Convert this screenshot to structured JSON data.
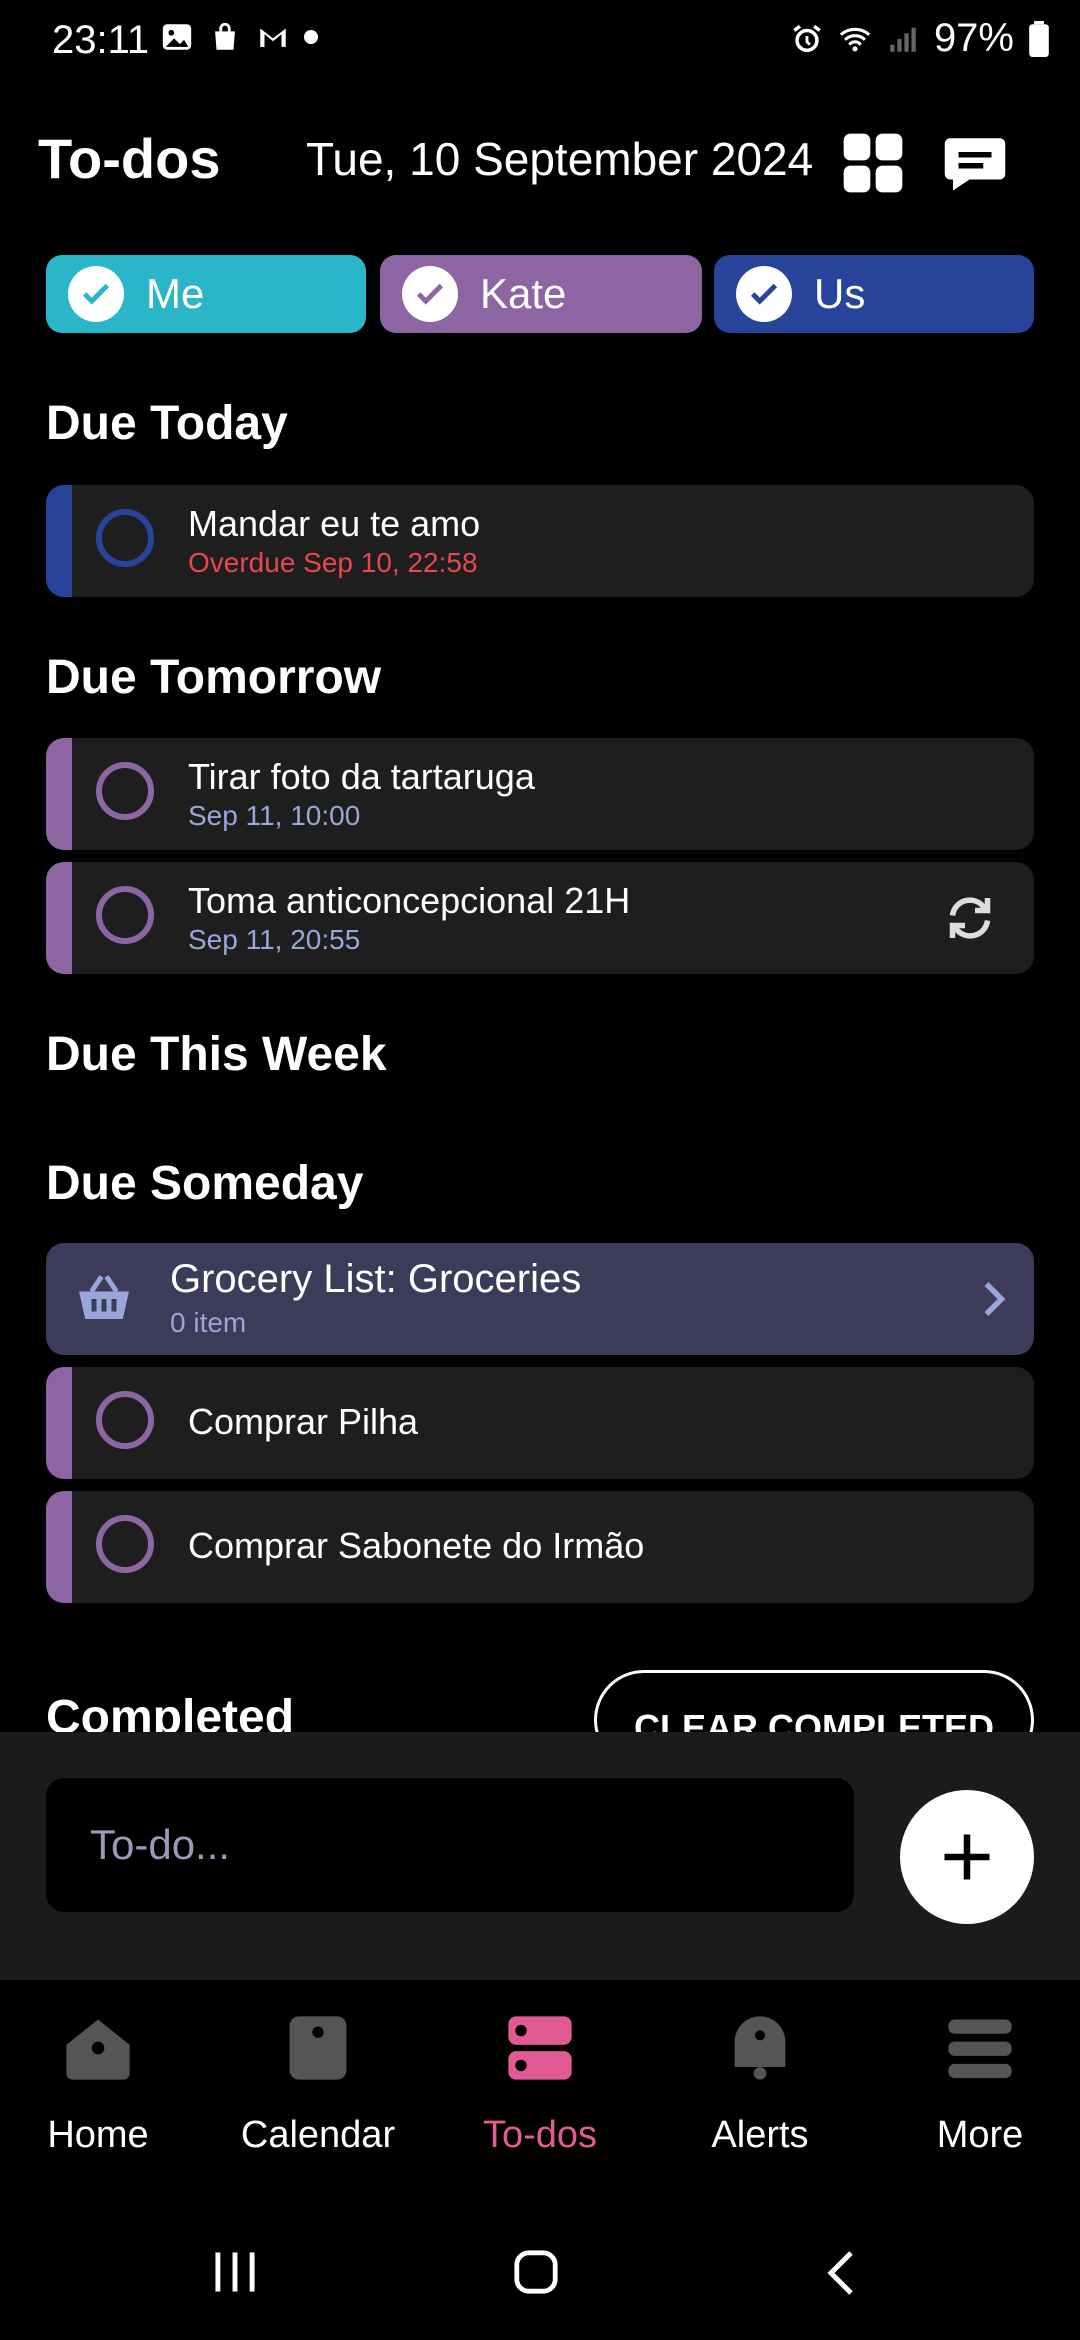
{
  "status_bar": {
    "time": "23:11",
    "battery": "97%"
  },
  "header": {
    "title": "To-dos",
    "date": "Tue, 10 September 2024"
  },
  "filters": [
    {
      "label": "Me",
      "color": "#2bb5c8"
    },
    {
      "label": "Kate",
      "color": "#8d65a3"
    },
    {
      "label": "Us",
      "color": "#27449a"
    }
  ],
  "sections": {
    "today": "Due Today",
    "tomorrow": "Due Tomorrow",
    "week": "Due This Week",
    "someday": "Due Someday",
    "completed": "Completed"
  },
  "todos": {
    "today_1": {
      "name": "Mandar eu te amo",
      "sub": "Overdue Sep 10, 22:58"
    },
    "tomorrow_1": {
      "name": "Tirar foto da tartaruga",
      "sub": "Sep 11, 10:00"
    },
    "tomorrow_2": {
      "name": "Toma anticoncepcional 21H",
      "sub": "Sep 11, 20:55"
    },
    "someday_1": {
      "name": "Comprar Pilha"
    },
    "someday_2": {
      "name": "Comprar Sabonete do Irmão"
    }
  },
  "grocery": {
    "title": "Grocery List: Groceries",
    "count": "0 item"
  },
  "clear_completed": "CLEAR COMPLETED",
  "input": {
    "placeholder": "To-do..."
  },
  "nav": [
    {
      "label": "Home"
    },
    {
      "label": "Calendar"
    },
    {
      "label": "To-dos",
      "active": true
    },
    {
      "label": "Alerts"
    },
    {
      "label": "More"
    }
  ],
  "colors": {
    "accent": "#e05a93",
    "overdue": "#e5484d",
    "sub_text": "#9aa6d9",
    "kate": "#8d65a3",
    "us": "#27449a"
  }
}
